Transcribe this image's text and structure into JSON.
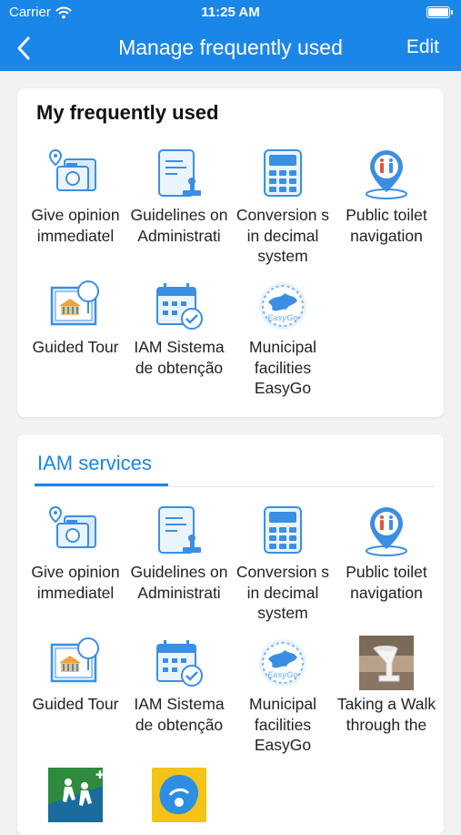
{
  "status": {
    "carrier": "Carrier",
    "time": "11:25 AM"
  },
  "navbar": {
    "title": "Manage frequently used",
    "edit_label": "Edit"
  },
  "frequent": {
    "title": "My frequently used",
    "items": [
      {
        "label": "Give opinion immediatel",
        "icon": "opinion-camera-icon"
      },
      {
        "label": "Guidelines on Administrati",
        "icon": "guidelines-document-icon"
      },
      {
        "label": "Conversion s in decimal system",
        "icon": "calculator-icon"
      },
      {
        "label": "Public toilet navigation",
        "icon": "toilet-location-pin-icon"
      },
      {
        "label": "Guided Tour",
        "icon": "guided-tour-building-icon"
      },
      {
        "label": "IAM Sistema de obtenção",
        "icon": "calendar-check-icon"
      },
      {
        "label": "Municipal facilities EasyGo",
        "icon": "easygo-globe-icon"
      }
    ]
  },
  "services": {
    "tab_label": "IAM services",
    "items": [
      {
        "label": "Give opinion immediatel",
        "icon": "opinion-camera-icon"
      },
      {
        "label": "Guidelines on Administrati",
        "icon": "guidelines-document-icon"
      },
      {
        "label": "Conversion s in decimal system",
        "icon": "calculator-icon"
      },
      {
        "label": "Public toilet navigation",
        "icon": "toilet-location-pin-icon"
      },
      {
        "label": "Guided Tour",
        "icon": "guided-tour-building-icon"
      },
      {
        "label": "IAM Sistema de obtenção",
        "icon": "calendar-check-icon"
      },
      {
        "label": "Municipal facilities EasyGo",
        "icon": "easygo-globe-icon"
      },
      {
        "label": "Taking a Walk through the",
        "icon": "walk-photo-icon"
      },
      {
        "label": "",
        "icon": "hiking-icon"
      },
      {
        "label": "",
        "icon": "safety-badge-icon"
      }
    ]
  }
}
